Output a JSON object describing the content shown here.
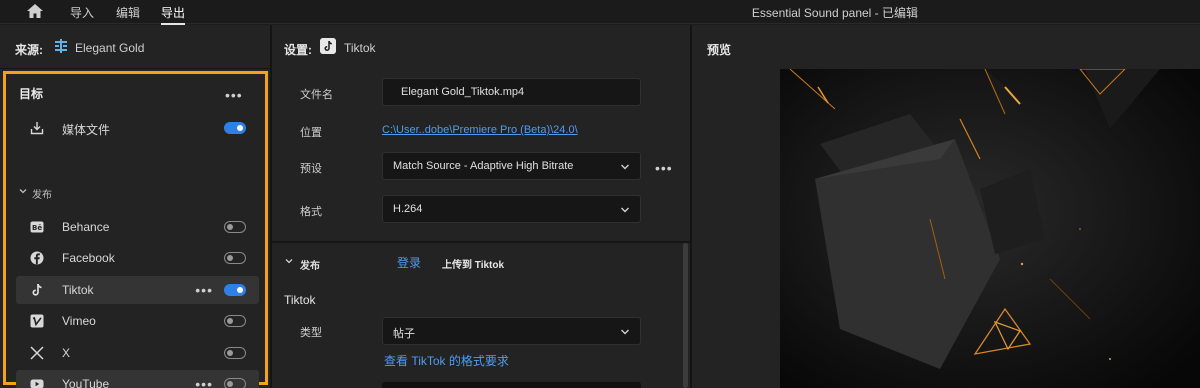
{
  "topbar": {
    "nav": [
      "导入",
      "编辑",
      "导出"
    ],
    "active_index": 2,
    "window_title": "Essential Sound panel - 已编辑"
  },
  "source": {
    "label": "来源:",
    "sequence": "Elegant Gold"
  },
  "destinations": {
    "title": "目标",
    "media_file": {
      "label": "媒体文件",
      "enabled": true
    },
    "publish_header": "发布",
    "platforms": [
      {
        "name": "Behance",
        "icon": "behance-icon",
        "enabled": false,
        "selected": false,
        "has_menu": false
      },
      {
        "name": "Facebook",
        "icon": "facebook-icon",
        "enabled": false,
        "selected": false,
        "has_menu": false
      },
      {
        "name": "Tiktok",
        "icon": "tiktok-icon",
        "enabled": true,
        "selected": true,
        "has_menu": true
      },
      {
        "name": "Vimeo",
        "icon": "vimeo-icon",
        "enabled": false,
        "selected": false,
        "has_menu": false
      },
      {
        "name": "X",
        "icon": "x-icon",
        "enabled": false,
        "selected": false,
        "has_menu": false
      },
      {
        "name": "YouTube",
        "icon": "youtube-icon",
        "enabled": false,
        "selected": true,
        "has_menu": true
      }
    ]
  },
  "settings": {
    "header": "设置:",
    "target": "Tiktok",
    "filename_label": "文件名",
    "filename": "Elegant Gold_Tiktok.mp4",
    "location_label": "位置",
    "location": "C:\\User..dobe\\Premiere Pro (Beta)\\24.0\\",
    "preset_label": "预设",
    "preset": "Match Source - Adaptive High Bitrate",
    "format_label": "格式",
    "format": "H.264",
    "publish_section": "发布",
    "login": "登录",
    "upload_to": "上传到 Tiktok",
    "tiktok_section": "Tiktok",
    "type_label": "类型",
    "type": "帖子",
    "requirements_link": "查看 TikTok 的格式要求"
  },
  "preview": {
    "label": "预览"
  },
  "colors": {
    "accent_highlight": "#f5a21b",
    "toggle_on": "#2d80e6",
    "link": "#4f9cf0"
  }
}
